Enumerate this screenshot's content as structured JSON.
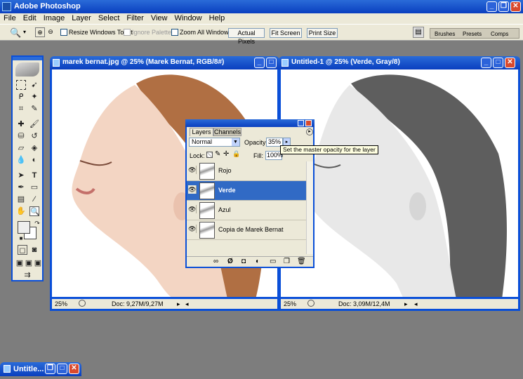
{
  "app": {
    "title": "Adobe Photoshop"
  },
  "menu": [
    "File",
    "Edit",
    "Image",
    "Layer",
    "Select",
    "Filter",
    "View",
    "Window",
    "Help"
  ],
  "options": {
    "resize_windows": "Resize Windows To Fit",
    "ignore_palettes": "Ignore Palettes",
    "zoom_all": "Zoom All Windows",
    "actual_pixels": "Actual Pixels",
    "fit_screen": "Fit Screen",
    "print_size": "Print Size"
  },
  "palette_well": {
    "tabs": [
      "Brushes",
      "Presets",
      "Comps"
    ]
  },
  "doc1": {
    "title": "marek bernat.jpg @ 25% (Marek Bernat, RGB/8#)",
    "zoom": "25%",
    "info": "Doc: 9,27M/9,27M"
  },
  "doc2": {
    "title": "Untitled-1 @ 25% (Verde, Gray/8)",
    "zoom": "25%",
    "info": "Doc: 3,09M/12,4M"
  },
  "layers": {
    "tabs": [
      "Layers",
      "Channels"
    ],
    "blend": "Normal",
    "opacity_label": "Opacity:",
    "opacity": "35%",
    "lock_label": "Lock:",
    "fill_label": "Fill:",
    "fill": "100%",
    "tooltip": "Set the master opacity for the layer",
    "items": [
      "Rojo",
      "Verde",
      "Azul",
      "Copia de Marek Bernat"
    ]
  },
  "minimized": {
    "title": "Untitle..."
  }
}
